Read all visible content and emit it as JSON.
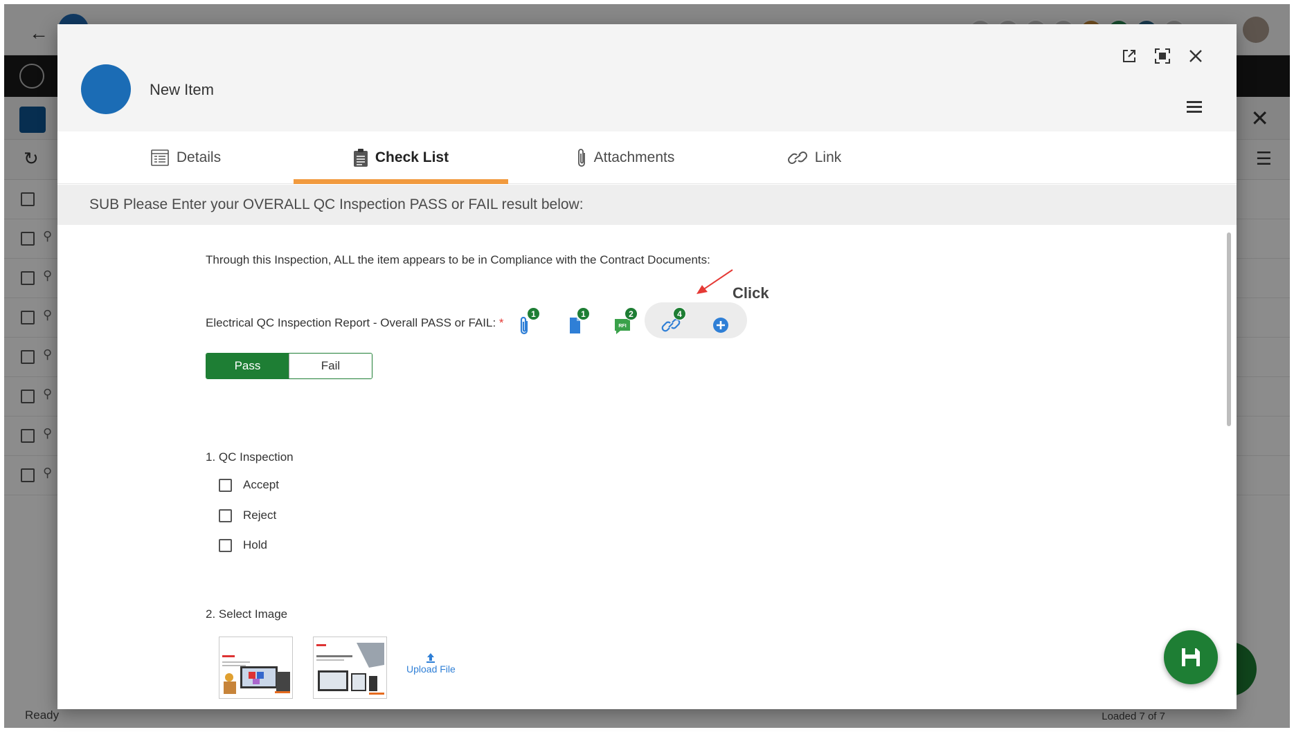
{
  "background_app": {
    "status_text": "Ready",
    "loaded_text": "Loaded 7 of 7"
  },
  "modal": {
    "title": "New Item",
    "tabs": [
      {
        "label": "Details",
        "icon": "details-icon",
        "active": false
      },
      {
        "label": "Check List",
        "icon": "clipboard-icon",
        "active": true
      },
      {
        "label": "Attachments",
        "icon": "paperclip-icon",
        "active": false
      },
      {
        "label": "Link",
        "icon": "link-icon",
        "active": false
      }
    ],
    "section_header": "SUB Please Enter your OVERALL QC Inspection PASS or FAIL result below:",
    "compliance_text": "Through this Inspection, ALL the item appears to be in Compliance with the Contract Documents:",
    "question": {
      "label": "Electrical QC Inspection Report - Overall PASS or FAIL:",
      "required_marker": "*",
      "counts": {
        "attachments": "1",
        "documents": "1",
        "rfi": "2",
        "links": "4"
      },
      "rfi_icon_text": "RFI",
      "annotation": "Click"
    },
    "pass_fail": {
      "pass_label": "Pass",
      "fail_label": "Fail",
      "selected": "Pass"
    },
    "qc_inspection": {
      "title": "1. QC Inspection",
      "options": [
        "Accept",
        "Reject",
        "Hold"
      ]
    },
    "select_image": {
      "title": "2. Select Image",
      "upload_label": "Upload File"
    },
    "colors": {
      "accent_green": "#1e7e34",
      "tab_underline": "#f19a3e",
      "avatar_blue": "#1b6cb5",
      "link_blue": "#2f7fd6",
      "required_red": "#e53935"
    }
  }
}
